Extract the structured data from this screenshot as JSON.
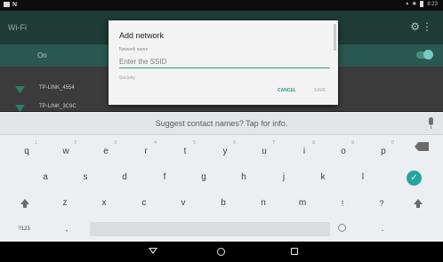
{
  "status_bar": {
    "left_letter": "N",
    "time": "8:23"
  },
  "wifi_screen": {
    "title": "Wi-Fi",
    "toggle_label": "On",
    "toggle_on": true,
    "networks": [
      {
        "name": "TP-LINK_4554"
      },
      {
        "name": "TP-LINK_3C9C"
      }
    ]
  },
  "dialog": {
    "title": "Add network",
    "network_name_label": "Network name",
    "ssid_placeholder": "Enter the SSID",
    "ssid_value": "",
    "security_label": "Security",
    "cancel_label": "CANCEL",
    "save_label": "SAVE"
  },
  "suggestion_strip": {
    "text": "Suggest contact names? Tap for info."
  },
  "keyboard": {
    "row1": [
      {
        "label": "q",
        "hint": "1"
      },
      {
        "label": "w",
        "hint": "2"
      },
      {
        "label": "e",
        "hint": "3"
      },
      {
        "label": "r",
        "hint": "4"
      },
      {
        "label": "t",
        "hint": "5"
      },
      {
        "label": "y",
        "hint": "6"
      },
      {
        "label": "u",
        "hint": "7"
      },
      {
        "label": "i",
        "hint": "8"
      },
      {
        "label": "o",
        "hint": "9"
      },
      {
        "label": "p",
        "hint": "0"
      }
    ],
    "row2": [
      "a",
      "s",
      "d",
      "f",
      "g",
      "h",
      "j",
      "k",
      "l"
    ],
    "row3": [
      "z",
      "x",
      "c",
      "v",
      "b",
      "n",
      "m",
      "!",
      "?"
    ],
    "symbols_label": "?123",
    "comma": ",",
    "period": "."
  },
  "colors": {
    "accent": "#26a69a",
    "dialog_accent": "#2e9a87"
  }
}
